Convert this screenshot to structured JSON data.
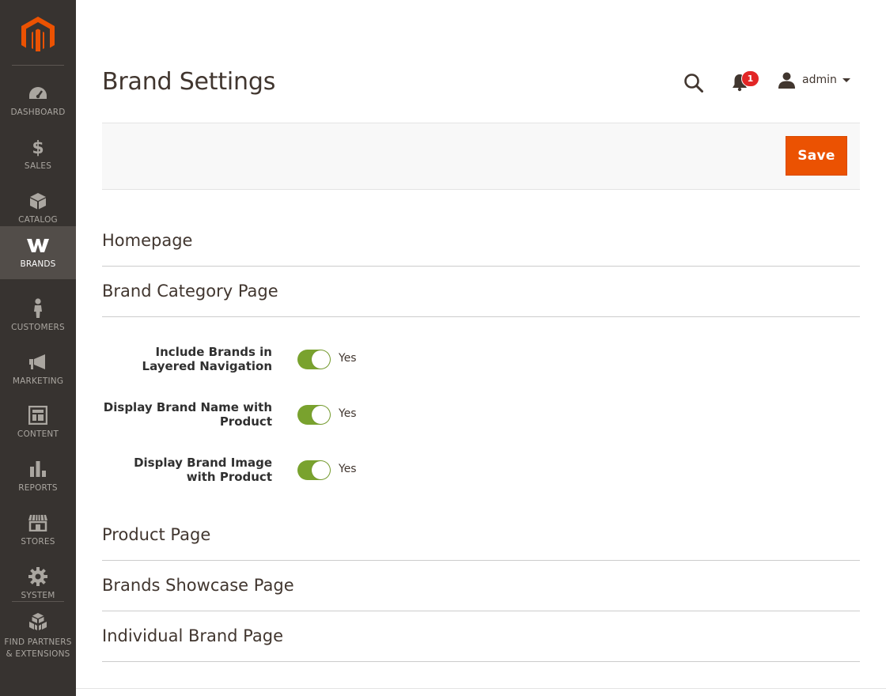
{
  "page": {
    "title": "Brand Settings"
  },
  "header": {
    "notification_count": "1",
    "user_name": "admin"
  },
  "toolbar": {
    "save_label": "Save"
  },
  "sidebar": {
    "items": [
      {
        "label": "DASHBOARD",
        "icon": "dashboard-icon"
      },
      {
        "label": "SALES",
        "icon": "dollar-icon"
      },
      {
        "label": "CATALOG",
        "icon": "box-icon"
      },
      {
        "label": "BRANDS",
        "icon": "brand-w-icon",
        "active": true
      },
      {
        "label": "CUSTOMERS",
        "icon": "person-icon"
      },
      {
        "label": "MARKETING",
        "icon": "megaphone-icon"
      },
      {
        "label": "CONTENT",
        "icon": "layout-icon"
      },
      {
        "label": "REPORTS",
        "icon": "bar-chart-icon"
      },
      {
        "label": "STORES",
        "icon": "storefront-icon"
      },
      {
        "label": "SYSTEM",
        "icon": "gear-icon"
      },
      {
        "label": "FIND PARTNERS & EXTENSIONS",
        "icon": "cubes-icon"
      }
    ]
  },
  "sections": {
    "homepage": "Homepage",
    "brand_category": "Brand Category Page",
    "product": "Product Page",
    "showcase": "Brands Showcase Page",
    "individual": "Individual Brand Page"
  },
  "fields": [
    {
      "label": "Include Brands in Layered Navigation",
      "value": "Yes",
      "enabled": true
    },
    {
      "label": "Display Brand Name with Product",
      "value": "Yes",
      "enabled": true
    },
    {
      "label": "Display Brand Image with Product",
      "value": "Yes",
      "enabled": true
    }
  ],
  "colors": {
    "sidebar_bg": "#373330",
    "sidebar_active": "#524d49",
    "accent": "#eb5202",
    "toggle_on": "#79a22e",
    "badge": "#e22626"
  }
}
